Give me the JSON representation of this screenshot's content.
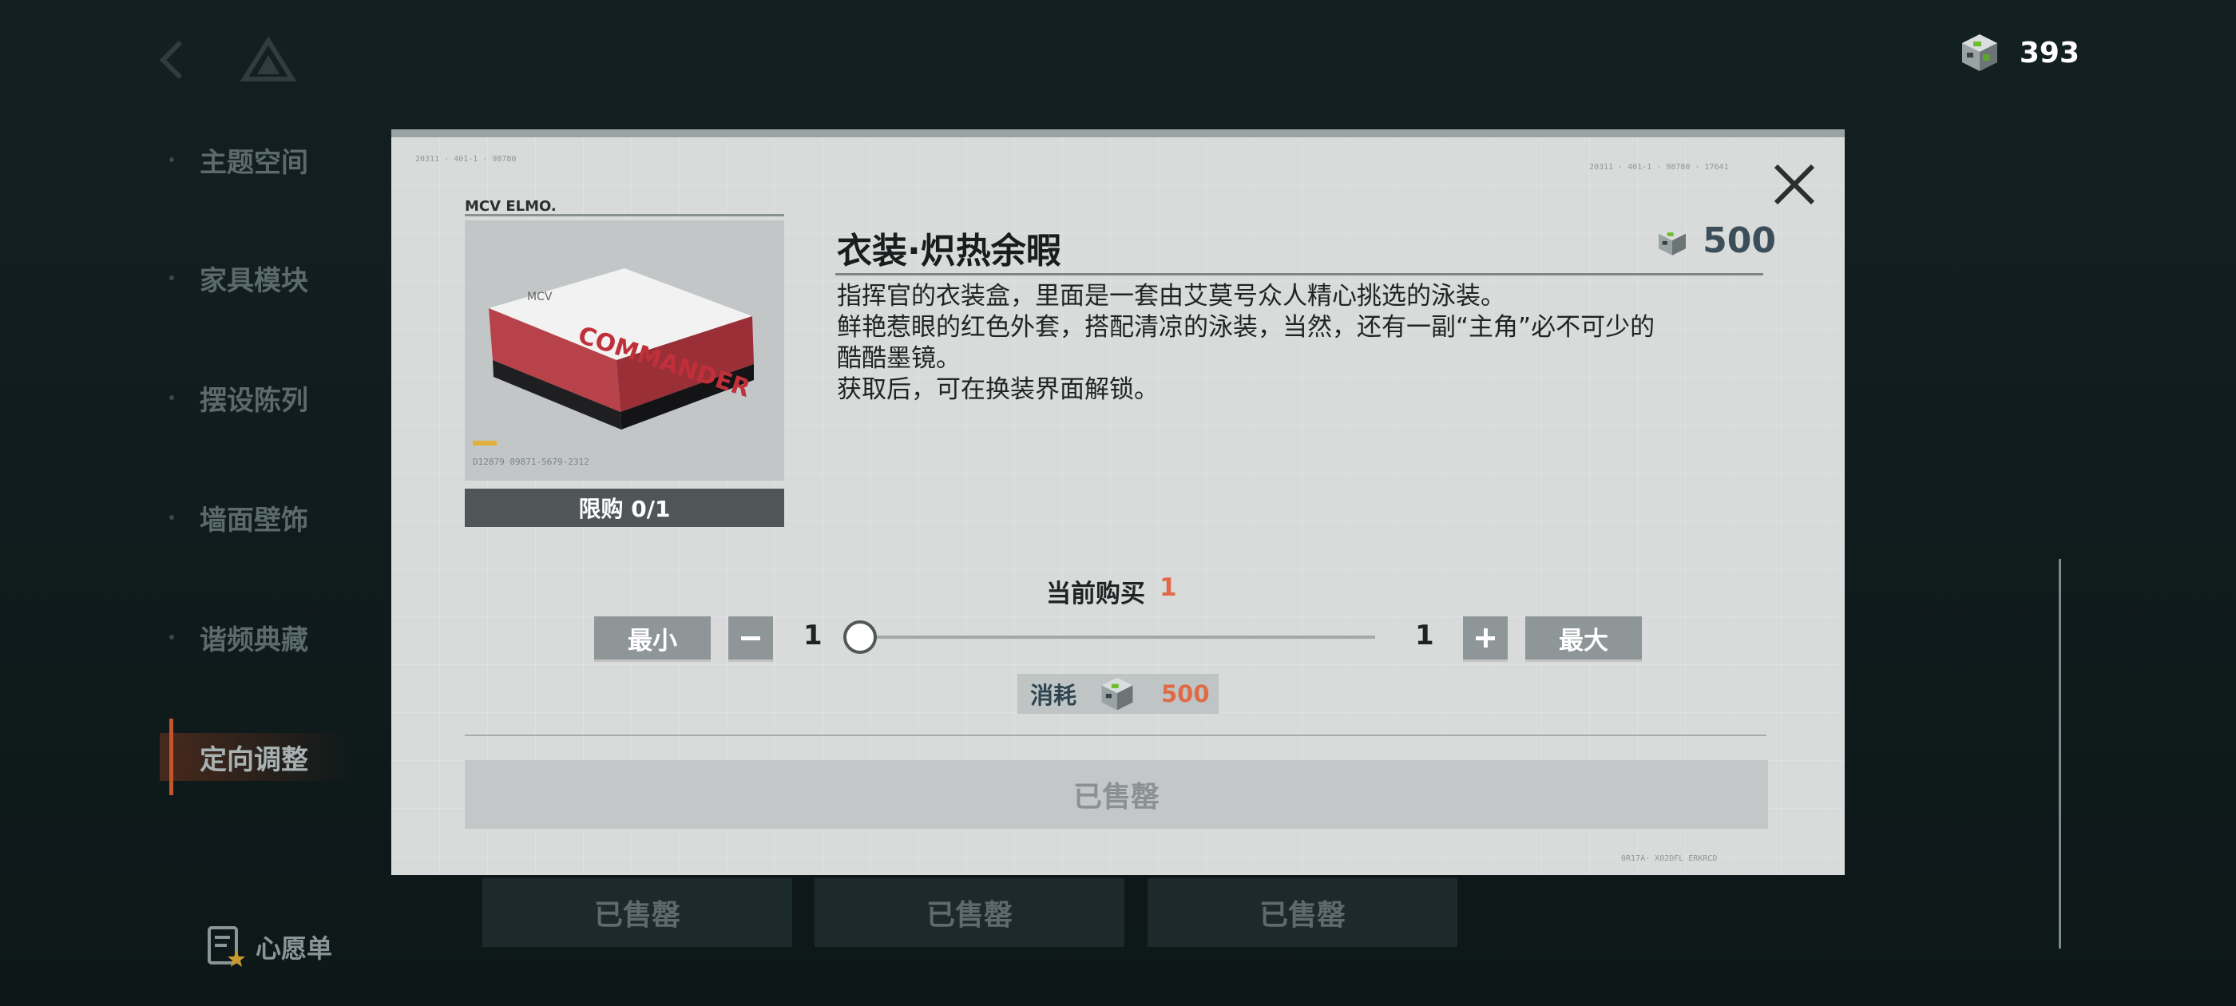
{
  "header": {
    "currency_value": "393"
  },
  "sidebar": {
    "items": [
      {
        "label": "主题空间"
      },
      {
        "label": "家具模块"
      },
      {
        "label": "摆设陈列"
      },
      {
        "label": "墙面壁饰"
      },
      {
        "label": "谐频典藏"
      },
      {
        "label": "定向调整"
      }
    ],
    "active": "定向调整",
    "wishlist_label": "心愿单"
  },
  "bottom_tabs": [
    "已售罄",
    "已售罄",
    "已售罄"
  ],
  "modal": {
    "image_brand": "MCV ELMO.",
    "box_text": "COMMANDER",
    "box_brand": "MCV",
    "image_code": "D12879 09871-5679-2312",
    "limit_label": "限购 0/1",
    "title": "衣装·炽热余暇",
    "price": "500",
    "description": [
      "指挥官的衣装盒，里面是一套由艾莫号众人精心挑选的泳装。",
      "鲜艳惹眼的红色外套，搭配清凉的泳装，当然，还有一副“主角”必不可少的",
      "酷酷墨镜。",
      "获取后，可在换装界面解锁。"
    ],
    "current_buy_label": "当前购买",
    "current_buy_value": "1",
    "min_label": "最小",
    "max_label": "最大",
    "qty_min": "1",
    "qty_max": "1",
    "quantity_fraction": 0,
    "cost_label": "消耗",
    "cost_value": "500",
    "sold_out_label": "已售罄",
    "deco_top_left": "20311 · 401-1 · 98780",
    "deco_top_right": "20311 · 401-1 · 98780 · 17641",
    "deco_bottom_right": "0R17A· X02DFL ERKRCD"
  },
  "colors": {
    "accent_red": "#e06a48",
    "price_text": "#3b4e5a",
    "sidebar_active": "#c2552a"
  },
  "icons": [
    "back-icon",
    "logo-icon",
    "resource-cube-icon",
    "close-icon",
    "minus-icon",
    "plus-icon",
    "wishlist-icon"
  ]
}
